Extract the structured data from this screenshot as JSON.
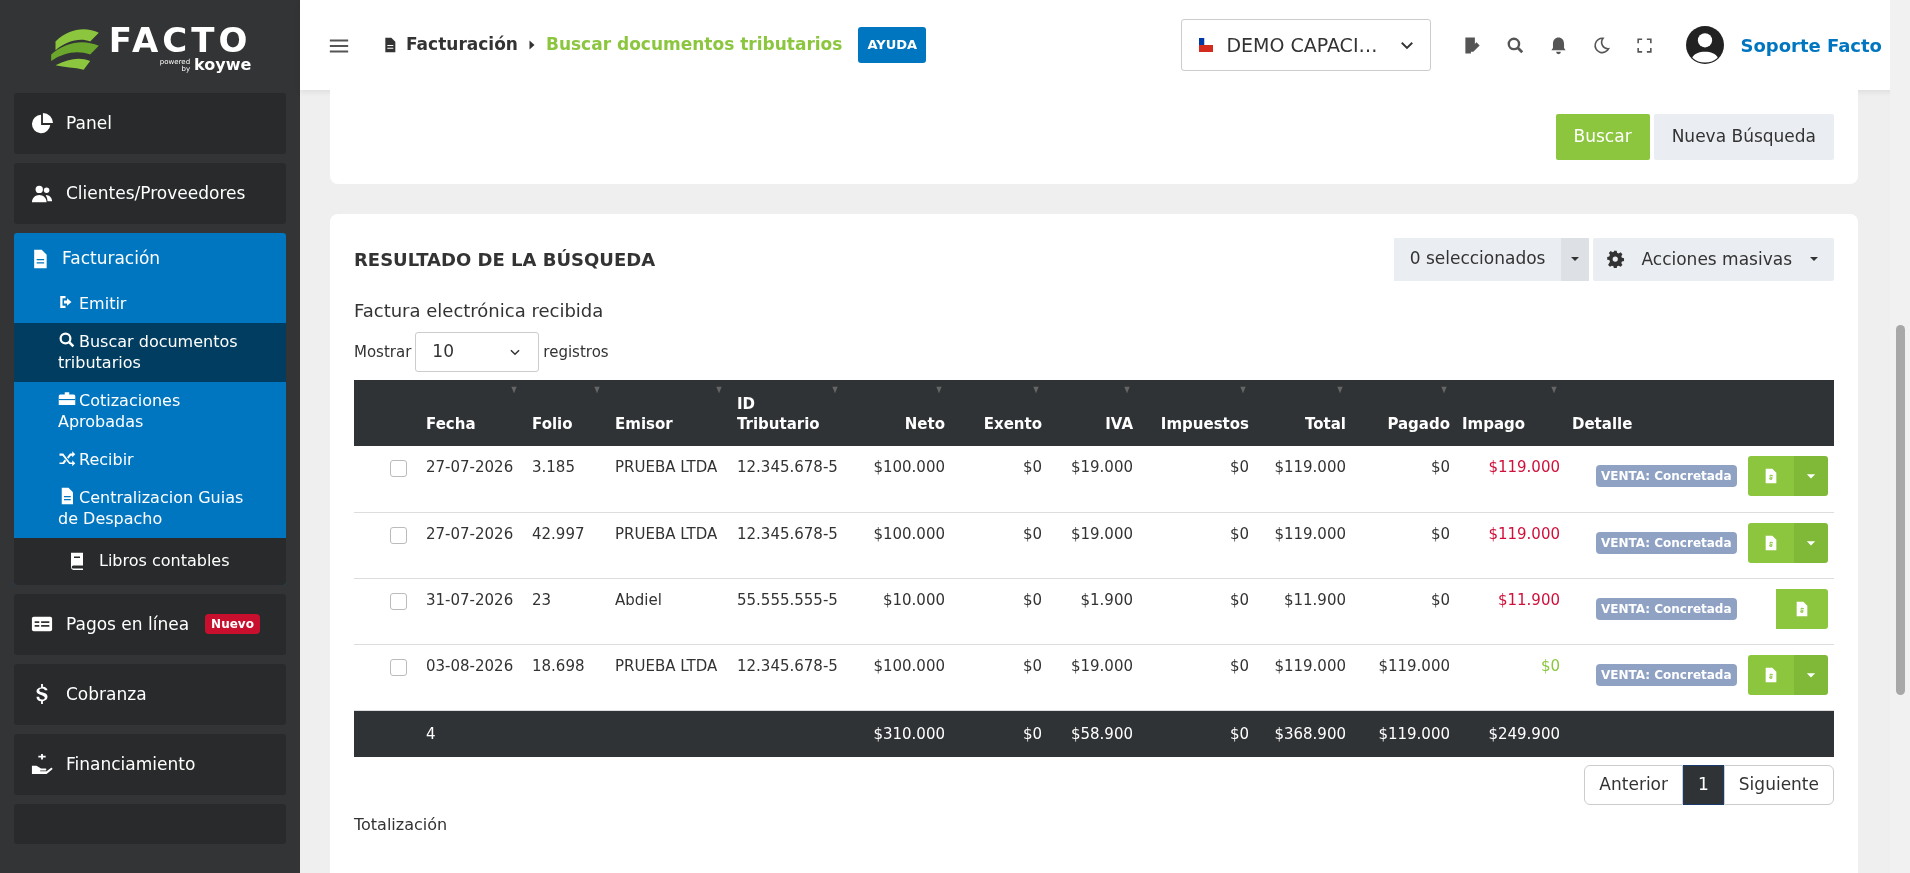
{
  "sidebar": {
    "logo": {
      "name": "FACTO",
      "powered": "powered",
      "by": "by",
      "brand": "koywe"
    },
    "items": [
      {
        "label": "Panel",
        "expanded": false
      },
      {
        "label": "Clientes/Proveedores",
        "expanded": false
      },
      {
        "label": "Facturación",
        "expanded": true,
        "children": [
          {
            "label": "Emitir",
            "selected": false,
            "kind": "link"
          },
          {
            "label": "Buscar documentos tributarios",
            "selected": true,
            "kind": "link"
          },
          {
            "label": "Cotizaciones Aprobadas",
            "selected": false,
            "kind": "link"
          },
          {
            "label": "Recibir",
            "selected": false,
            "kind": "link"
          },
          {
            "label": "Centralizacion Guias de Despacho",
            "selected": false,
            "kind": "link"
          },
          {
            "label": "Libros contables",
            "selected": false,
            "kind": "module"
          }
        ]
      },
      {
        "label": "Pagos en línea",
        "expanded": false,
        "badge": "Nuevo"
      },
      {
        "label": "Cobranza",
        "expanded": false
      },
      {
        "label": "Financiamiento",
        "expanded": false
      }
    ]
  },
  "header": {
    "breadcrumb": [
      "Facturación",
      "Buscar documentos tributarios"
    ],
    "help": "AYUDA",
    "company": "DEMO CAPACI…",
    "user": "Soporte Facto"
  },
  "search_card": {
    "buttons": [
      "Buscar",
      "Nueva Búsqueda"
    ]
  },
  "results": {
    "title": "RESULTADO DE LA BÚSQUEDA",
    "selected_count": "0 seleccionados",
    "bulk_actions": "Acciones masivas",
    "subtitle": "Factura electrónica recibida",
    "page_length": {
      "prefix": "Mostrar",
      "value": "10",
      "suffix": "registros"
    },
    "columns": [
      "Fecha",
      "Folio",
      "Emisor",
      "ID Tributario",
      "Neto",
      "Exento",
      "IVA",
      "Impuestos",
      "Total",
      "Pagado",
      "Impago",
      "Detalle"
    ],
    "rows": [
      {
        "checked": false,
        "cells": [
          "27-07-2026",
          "3.185",
          "PRUEBA LTDA",
          "12.345.678-5",
          "$100.000",
          "$0",
          "$19.000",
          "$0",
          "$119.000",
          "$0",
          "$119.000"
        ],
        "paid": false,
        "status": "VENTA: Concretada",
        "has_dropdown": true
      },
      {
        "checked": false,
        "cells": [
          "27-07-2026",
          "42.997",
          "PRUEBA LTDA",
          "12.345.678-5",
          "$100.000",
          "$0",
          "$19.000",
          "$0",
          "$119.000",
          "$0",
          "$119.000"
        ],
        "paid": false,
        "status": "VENTA: Concretada",
        "has_dropdown": true
      },
      {
        "checked": false,
        "cells": [
          "31-07-2026",
          "23",
          "Abdiel",
          "55.555.555-5",
          "$10.000",
          "$0",
          "$1.900",
          "$0",
          "$11.900",
          "$0",
          "$11.900"
        ],
        "paid": false,
        "status": "VENTA: Concretada",
        "has_dropdown": false
      },
      {
        "checked": false,
        "cells": [
          "03-08-2026",
          "18.698",
          "PRUEBA LTDA",
          "12.345.678-5",
          "$100.000",
          "$0",
          "$19.000",
          "$0",
          "$119.000",
          "$119.000",
          "$0"
        ],
        "paid": true,
        "status": "VENTA: Concretada",
        "has_dropdown": true
      }
    ],
    "totals": {
      "fecha": "4",
      "neto": "$310.000",
      "exento": "$0",
      "iva": "$58.900",
      "impuestos": "$0",
      "total": "$368.900",
      "pagado": "$119.000",
      "impago": "$249.900"
    },
    "pagination": [
      {
        "label": "Anterior",
        "selected": false
      },
      {
        "label": "1",
        "selected": true
      },
      {
        "label": "Siguiente",
        "selected": false
      }
    ]
  },
  "footer_title": "Totalización"
}
